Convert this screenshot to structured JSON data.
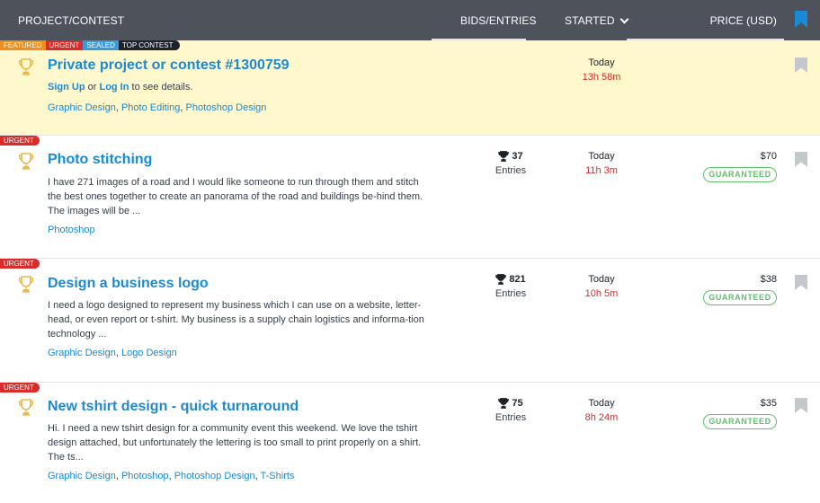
{
  "header": {
    "project_col": "PROJECT/CONTEST",
    "bids_col": "BIDS/ENTRIES",
    "started_col": "STARTED",
    "price_col": "PRICE (USD)",
    "icons": {
      "sort": "chevron-down-icon",
      "bookmark": "bookmark-icon"
    }
  },
  "colors": {
    "header_bg": "#4d525b",
    "link_blue": "#1a8ad4",
    "urgent_red": "#d82b2b",
    "featured_orange": "#ef8e1c",
    "sealed_blue": "#3b9bd8",
    "guaranteed_green": "#5dc26a",
    "featured_row_bg": "#fff8cc",
    "trophy_gold": "#e8b84a",
    "bookmark_gray": "#c4c7cc",
    "bookmark_active": "#1a8ad4"
  },
  "rows": [
    {
      "tags": [
        "FEATURED",
        "URGENT",
        "SEALED",
        "TOP CONTEST"
      ],
      "title": "Private project or contest #1300759",
      "login": {
        "sign_up": "Sign Up",
        "or": "or",
        "log_in": "Log In",
        "suffix": "to see details."
      },
      "skills": [
        "Graphic Design",
        "Photo Editing",
        "Photoshop Design"
      ],
      "started_day": "Today",
      "started_time": "13h 58m"
    },
    {
      "tags": [
        "URGENT"
      ],
      "title": "Photo stitching",
      "description": "I have 271 images of a road and I would like someone to run through them and stitch the best ones together to create an panorama of the road and buildings be-hind them. The images will be ...",
      "skills": [
        "Photoshop"
      ],
      "entries_count": "37",
      "entries_label": "Entries",
      "started_day": "Today",
      "started_time": "11h 3m",
      "price": "$70",
      "guarantee": "GUARANTEED"
    },
    {
      "tags": [
        "URGENT"
      ],
      "title": "Design a business logo",
      "description": "I need a logo designed to represent my business which I can use on a website, letter-head, or even report or t-shirt. My business is a supply chain logistics and informa-tion technology ...",
      "skills": [
        "Graphic Design",
        "Logo Design"
      ],
      "entries_count": "821",
      "entries_label": "Entries",
      "started_day": "Today",
      "started_time": "10h 5m",
      "price": "$38",
      "guarantee": "GUARANTEED"
    },
    {
      "tags": [
        "URGENT"
      ],
      "title": "New tshirt design - quick turnaround",
      "description": "Hi. I need a new tshirt design for a community event this weekend. We love the tshirt design attached, but unfortunately the lettering is too small to print properly on a shirt. The ts...",
      "skills": [
        "Graphic Design",
        "Photoshop",
        "Photoshop Design",
        "T-Shirts"
      ],
      "entries_count": "75",
      "entries_label": "Entries",
      "started_day": "Today",
      "started_time": "8h 24m",
      "price": "$35",
      "guarantee": "GUARANTEED"
    }
  ]
}
